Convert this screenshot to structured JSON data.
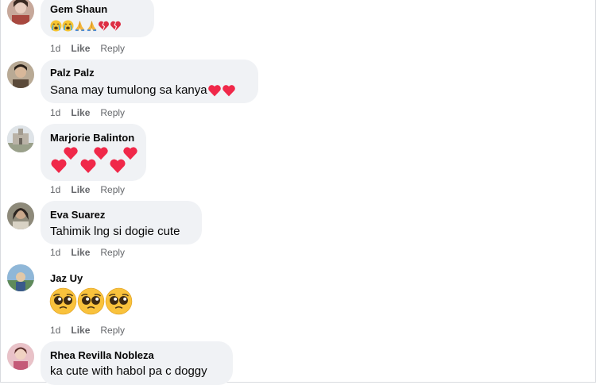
{
  "comments": [
    {
      "name": "Gem Shaun",
      "text": "😭😭🙏🙏💔💔",
      "time": "1d",
      "like": "Like",
      "reply": "Reply"
    },
    {
      "name": "Palz Palz",
      "text": "Sana may tumulong sa kanya",
      "time": "1d",
      "like": "Like",
      "reply": "Reply"
    },
    {
      "name": "Marjorie Balinton",
      "text": "",
      "time": "1d",
      "like": "Like",
      "reply": "Reply"
    },
    {
      "name": "Eva Suarez",
      "text": "Tahimik lng si dogie cute",
      "time": "1d",
      "like": "Like",
      "reply": "Reply"
    },
    {
      "name": "Jaz Uy",
      "text": "🥺🥺🥺",
      "time": "1d",
      "like": "Like",
      "reply": "Reply"
    },
    {
      "name": "Rhea Revilla Nobleza",
      "text": "ka cute with habol pa c doggy",
      "time": "",
      "like": "",
      "reply": ""
    }
  ],
  "colors": {
    "bubble": "#f0f2f5",
    "heart": "#f02849",
    "meta": "#65676b"
  },
  "icons": {
    "heart": "red-heart-icon",
    "broken_heart": "broken-heart-icon",
    "crying": "crying-face-icon",
    "praying": "praying-hands-icon",
    "pleading": "pleading-face-icon"
  }
}
